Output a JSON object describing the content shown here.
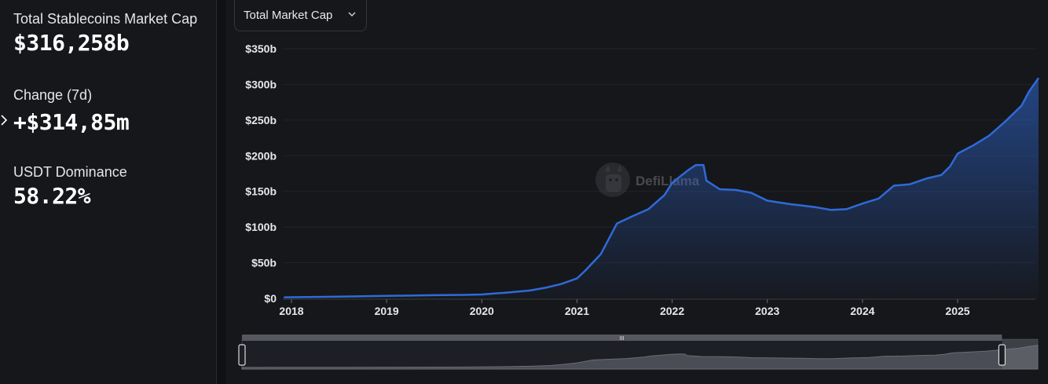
{
  "stats": {
    "market_cap_label": "Total Stablecoins Market Cap",
    "market_cap_value": "$316,258b",
    "change_label": "Change (7d)",
    "change_value": "+$314,85m",
    "dominance_label": "USDT Dominance",
    "dominance_value": "58.22%"
  },
  "dropdown": {
    "selected": "Total Market Cap"
  },
  "watermark": "DefiLlama",
  "colors": {
    "accent": "#2f6ad8",
    "background": "#16171b",
    "text": "#ffffff"
  },
  "icons": [
    "chevron-right-icon",
    "chevron-down-icon",
    "defillama-logo-icon"
  ],
  "chart_data": {
    "type": "area",
    "x_unit": "year",
    "ylim": [
      0,
      350
    ],
    "y_ticks": [
      {
        "value": 0,
        "label": "$0"
      },
      {
        "value": 50,
        "label": "$50b"
      },
      {
        "value": 100,
        "label": "$100b"
      },
      {
        "value": 150,
        "label": "$150b"
      },
      {
        "value": 200,
        "label": "$200b"
      },
      {
        "value": 250,
        "label": "$250b"
      },
      {
        "value": 300,
        "label": "$300b"
      },
      {
        "value": 350,
        "label": "$350b"
      }
    ],
    "x_ticks": [
      {
        "value": 2018,
        "label": "2018"
      },
      {
        "value": 2019,
        "label": "2019"
      },
      {
        "value": 2020,
        "label": "2020"
      },
      {
        "value": 2021,
        "label": "2021"
      },
      {
        "value": 2022,
        "label": "2022"
      },
      {
        "value": 2023,
        "label": "2023"
      },
      {
        "value": 2024,
        "label": "2024"
      },
      {
        "value": 2025,
        "label": "2025"
      }
    ],
    "grid": true,
    "legend": "none",
    "series": [
      {
        "points": [
          [
            2017.92,
            1.5
          ],
          [
            2018.5,
            2.5
          ],
          [
            2019.0,
            3.5
          ],
          [
            2019.5,
            4.5
          ],
          [
            2019.83,
            5
          ],
          [
            2020.0,
            5.5
          ],
          [
            2020.25,
            8
          ],
          [
            2020.5,
            11
          ],
          [
            2020.67,
            15
          ],
          [
            2020.83,
            20
          ],
          [
            2021.0,
            28
          ],
          [
            2021.08,
            38
          ],
          [
            2021.25,
            62
          ],
          [
            2021.42,
            105
          ],
          [
            2021.58,
            115
          ],
          [
            2021.75,
            125
          ],
          [
            2021.92,
            145
          ],
          [
            2022.0,
            162
          ],
          [
            2022.17,
            180
          ],
          [
            2022.25,
            187
          ],
          [
            2022.33,
            187
          ],
          [
            2022.36,
            165
          ],
          [
            2022.5,
            153
          ],
          [
            2022.67,
            152
          ],
          [
            2022.83,
            148
          ],
          [
            2023.0,
            137
          ],
          [
            2023.25,
            132
          ],
          [
            2023.5,
            128
          ],
          [
            2023.67,
            124
          ],
          [
            2023.83,
            125
          ],
          [
            2024.0,
            133
          ],
          [
            2024.17,
            140
          ],
          [
            2024.33,
            158
          ],
          [
            2024.5,
            160
          ],
          [
            2024.67,
            168
          ],
          [
            2024.83,
            173
          ],
          [
            2024.92,
            185
          ],
          [
            2025.0,
            203
          ],
          [
            2025.17,
            215
          ],
          [
            2025.33,
            228
          ],
          [
            2025.5,
            248
          ],
          [
            2025.67,
            270
          ],
          [
            2025.75,
            290
          ],
          [
            2025.85,
            309
          ]
        ]
      }
    ]
  },
  "brush": {
    "handle_label": "III",
    "range_start": 0,
    "range_end": 0.955
  }
}
